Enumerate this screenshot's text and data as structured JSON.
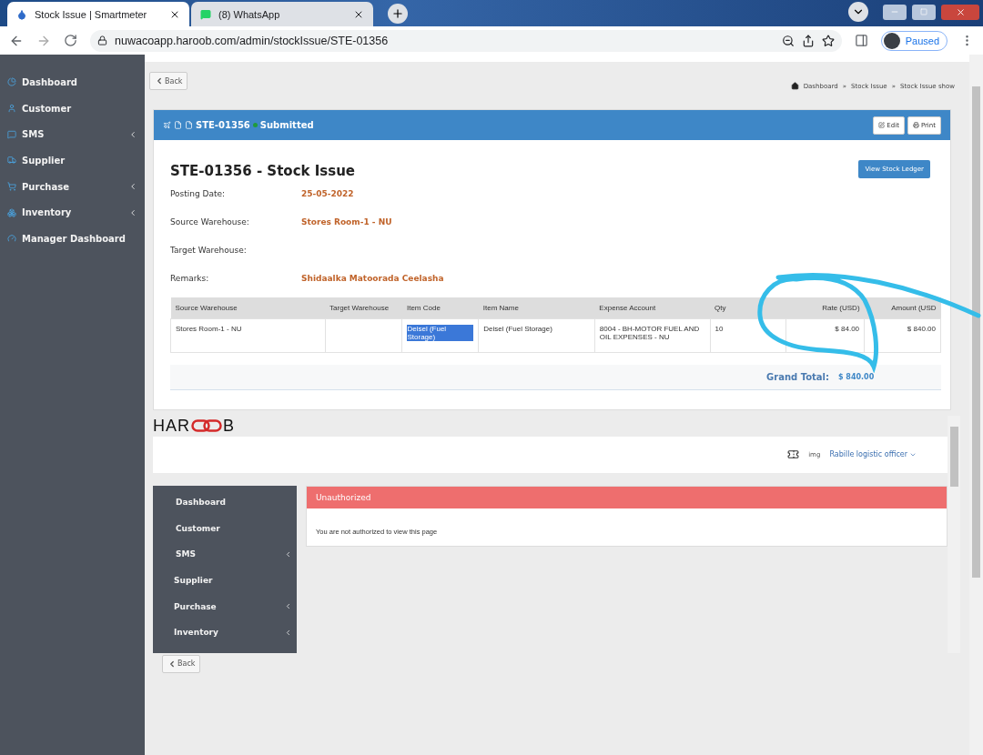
{
  "browser": {
    "tabs": [
      {
        "title": "Stock Issue | Smartmeter",
        "selected": true,
        "kind": "drop"
      },
      {
        "title": "(8) WhatsApp",
        "selected": false,
        "kind": "chat"
      }
    ],
    "url": "nuwacoapp.haroob.com/admin/stockIssue/STE-01356",
    "profile": "Paused"
  },
  "sidebar": {
    "items": [
      {
        "label": "Dashboard",
        "expandable": false
      },
      {
        "label": "Customer",
        "expandable": false
      },
      {
        "label": "SMS",
        "expandable": true
      },
      {
        "label": "Supplier",
        "expandable": false
      },
      {
        "label": "Purchase",
        "expandable": true
      },
      {
        "label": "Inventory",
        "expandable": true
      },
      {
        "label": "Manager Dashboard",
        "expandable": false
      }
    ]
  },
  "back": "Back",
  "breadcrumb": {
    "items": [
      "Dashboard",
      "Stock Issue",
      "Stock Issue show"
    ],
    "separator": "»"
  },
  "card": {
    "id": "STE-01356",
    "status": "Submitted",
    "buttons": [
      "Edit",
      "Print"
    ],
    "title": "STE-01356 - Stock Issue",
    "ledger_button": "View Stock Ledger",
    "fields": [
      {
        "label": "Posting Date:",
        "value": "25-05-2022"
      },
      {
        "label": "Source Warehouse:",
        "value": "Stores Room-1 - NU"
      },
      {
        "label": "Target Warehouse:"
      },
      {
        "label": "Remarks:",
        "value": "Shidaalka Matoorada Ceelasha"
      }
    ],
    "table": {
      "columns": [
        "Source Warehouse",
        "Target Warehouse",
        "Item Code",
        "Item Name",
        "Expense Account",
        "Qty",
        "Rate (USD)",
        "Amount (USD"
      ],
      "rows": [
        {
          "cells": [
            {
              "text": "Stores Room-1 - NU",
              "highlighted": false
            },
            {
              "text": "",
              "highlighted": false
            },
            {
              "text": "Deisel (Fuel Storage)",
              "highlighted": true
            },
            {
              "text": "Deisel (Fuel Storage)",
              "highlighted": false
            },
            {
              "text": "8004 - BH-MOTOR FUEL AND OIL EXPENSES - NU",
              "highlighted": false
            },
            {
              "text": "10",
              "highlighted": false
            },
            {
              "text": "$ 84.00",
              "highlighted": false
            },
            {
              "text": "$ 840.00",
              "highlighted": false
            }
          ]
        }
      ]
    },
    "grand_total": {
      "label": "Grand Total:",
      "value": "$ 840.00"
    }
  },
  "embedded": {
    "logo": {
      "before": "HAR",
      "after": "B"
    },
    "img_alt": "img",
    "user": "Rabille logistic officer",
    "sidebar": [
      {
        "label": "Dashboard",
        "expandable": false
      },
      {
        "label": "Customer",
        "expandable": false
      },
      {
        "label": "SMS",
        "expandable": true
      },
      {
        "label": "Supplier",
        "expandable": false
      },
      {
        "label": "Purchase",
        "expandable": true
      },
      {
        "label": "Inventory",
        "expandable": true
      }
    ],
    "alert": {
      "title": "Unauthorized",
      "message": "You are not authorized to view this page"
    }
  },
  "bottom_back": "Back"
}
